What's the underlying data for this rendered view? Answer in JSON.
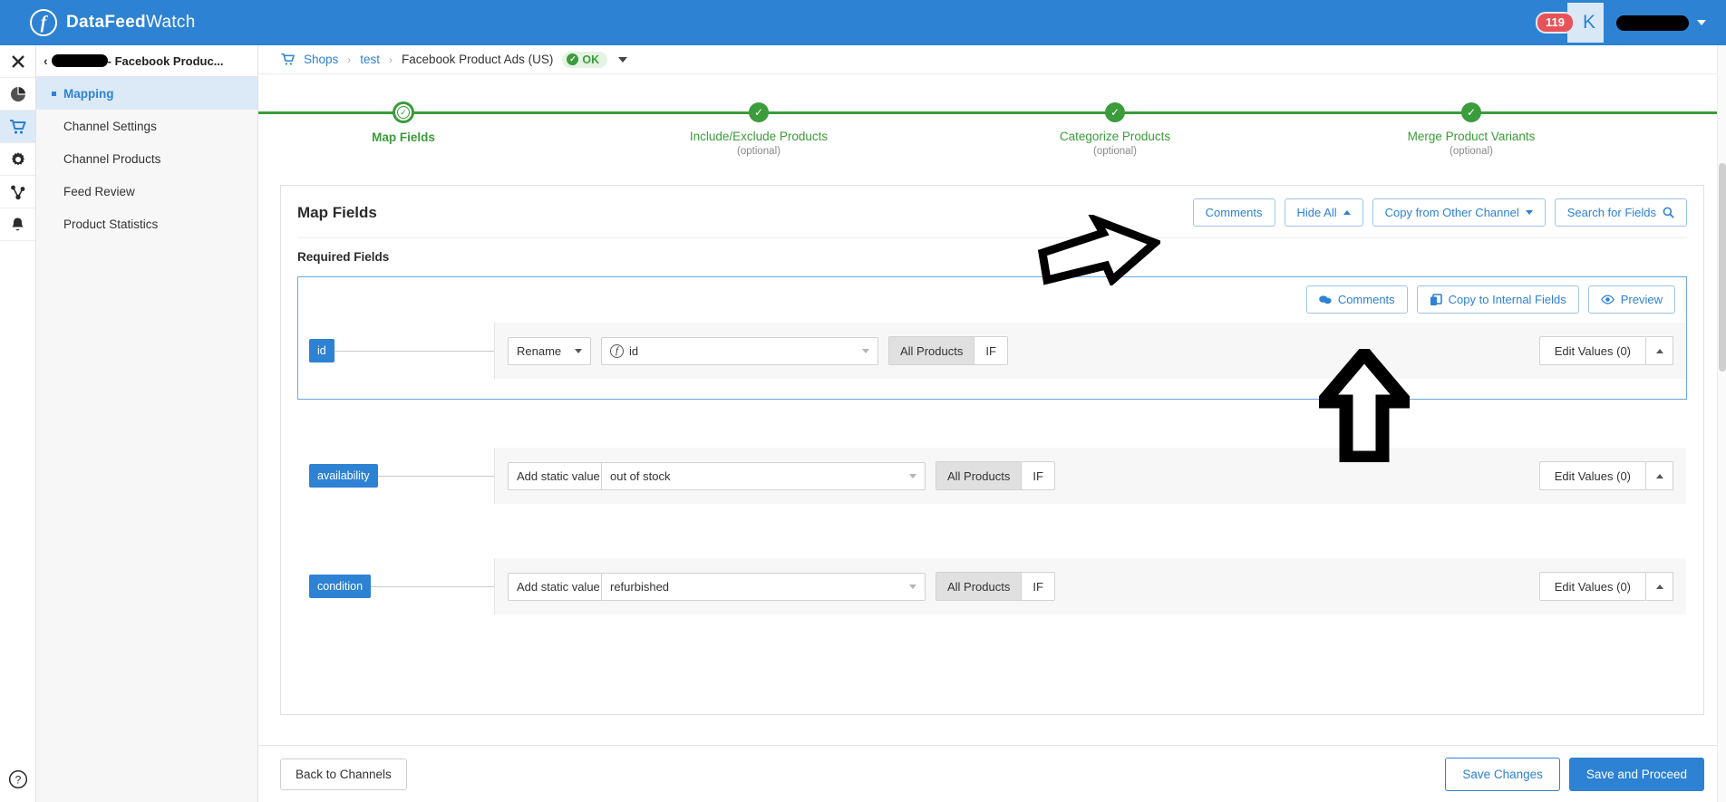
{
  "header": {
    "brand_bold": "DataFeed",
    "brand_light": "Watch",
    "logo_glyph": "f",
    "notification_count": "119",
    "avatar_initial": "K",
    "brand_color": "#2d82d3"
  },
  "rail": {
    "items": [
      {
        "name": "close-icon",
        "label": "Close"
      },
      {
        "name": "dashboard-icon",
        "label": "Dashboard"
      },
      {
        "name": "cart-icon",
        "label": "Shops"
      },
      {
        "name": "gear-icon",
        "label": "Settings"
      },
      {
        "name": "share-icon",
        "label": "Integrations"
      },
      {
        "name": "bell-icon",
        "label": "Notifications"
      }
    ],
    "help_label": "?"
  },
  "nav": {
    "back_caret": "‹",
    "header_suffix": "- Facebook Produc...",
    "items": [
      {
        "label": "Mapping",
        "active": true
      },
      {
        "label": "Channel Settings",
        "active": false
      },
      {
        "label": "Channel Products",
        "active": false
      },
      {
        "label": "Feed Review",
        "active": false
      },
      {
        "label": "Product Statistics",
        "active": false
      }
    ]
  },
  "breadcrumb": {
    "shop_icon": "cart-icon",
    "items": [
      "Shops",
      "test"
    ],
    "separator": "›",
    "current": "Facebook Product Ads (US)",
    "status": "OK",
    "status_check": "✓",
    "status_color": "#3a9c3a"
  },
  "steps": [
    {
      "label": "Map Fields",
      "sub": "",
      "current": true,
      "check": "✓"
    },
    {
      "label": "Include/Exclude Products",
      "sub": "(optional)",
      "current": false,
      "check": "✓"
    },
    {
      "label": "Categorize Products",
      "sub": "(optional)",
      "current": false,
      "check": "✓"
    },
    {
      "label": "Merge Product Variants",
      "sub": "(optional)",
      "current": false,
      "check": "✓"
    }
  ],
  "panel": {
    "title": "Map Fields",
    "section_label": "Required Fields",
    "tools": {
      "comments": "Comments",
      "hide_all": "Hide All",
      "copy_from_other_channel": "Copy from Other Channel",
      "search_for_fields": "Search for Fields",
      "search_icon": "search-icon"
    },
    "block_tools": {
      "comments": "Comments",
      "comments_icon": "comments-icon",
      "copy_to_internal_fields": "Copy to Internal Fields",
      "copy_icon": "copy-icon",
      "preview": "Preview",
      "preview_icon": "eye-icon"
    },
    "rows": [
      {
        "tag": "id",
        "action": "Rename",
        "value": "id",
        "value_has_fx": true,
        "fx_glyph": "f",
        "scope_all": "All Products",
        "scope_if": "IF",
        "edit_values": "Edit Values (0)",
        "selected": true
      },
      {
        "tag": "availability",
        "action": "Add static value",
        "value": "out of stock",
        "value_has_fx": false,
        "fx_glyph": "",
        "scope_all": "All Products",
        "scope_if": "IF",
        "edit_values": "Edit Values (0)",
        "selected": false
      },
      {
        "tag": "condition",
        "action": "Add static value",
        "value": "refurbished",
        "value_has_fx": false,
        "fx_glyph": "",
        "scope_all": "All Products",
        "scope_if": "IF",
        "edit_values": "Edit Values (0)",
        "selected": false
      }
    ]
  },
  "footer": {
    "back_to_channels": "Back to Channels",
    "save_changes": "Save Changes",
    "save_and_proceed": "Save and Proceed"
  },
  "annotations": [
    {
      "name": "arrow-right-annotation",
      "direction": "right"
    },
    {
      "name": "arrow-up-annotation",
      "direction": "up"
    }
  ]
}
